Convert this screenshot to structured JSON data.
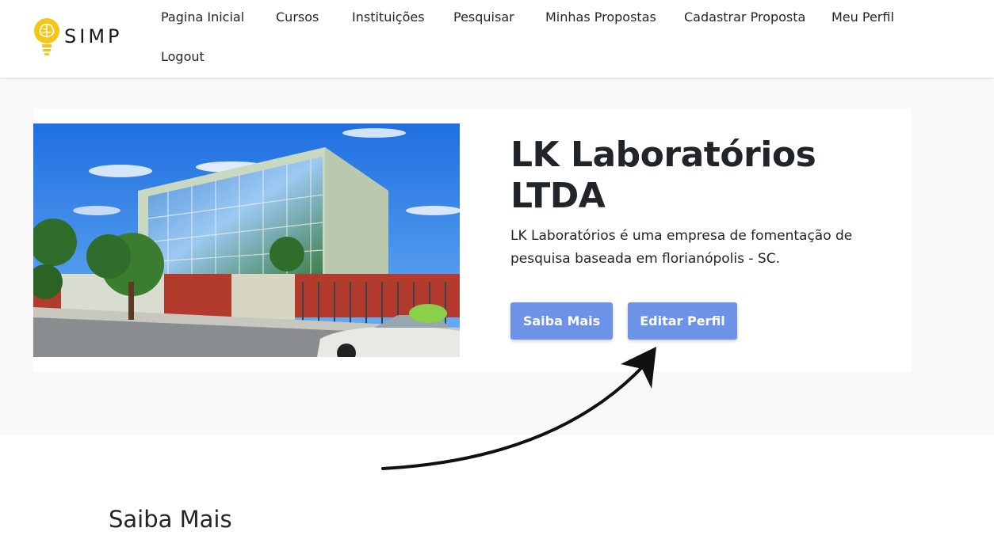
{
  "brand": {
    "name": "SIMP",
    "logo_icon": "brain-lightbulb-icon",
    "accent": "#f5c518"
  },
  "nav": {
    "items": [
      {
        "label": "Pagina Inicial"
      },
      {
        "label": "Cursos"
      },
      {
        "label": "Instituições"
      },
      {
        "label": "Pesquisar"
      },
      {
        "label": "Minhas Propostas"
      },
      {
        "label": "Cadastrar Proposta"
      },
      {
        "label": "Meu Perfil"
      },
      {
        "label": "Logout"
      }
    ]
  },
  "profile": {
    "title": "LK Laboratórios LTDA",
    "description": "LK Laboratórios é uma empresa de fomentação de pesquisa baseada em florianópolis - SC.",
    "buttons": {
      "learn_more": "Saiba Mais",
      "edit_profile": "Editar Perfil"
    },
    "button_color": "#6d93e8"
  },
  "section": {
    "title": "Saiba Mais"
  }
}
